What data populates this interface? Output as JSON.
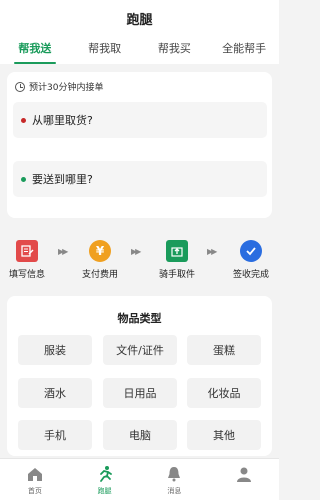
{
  "header": {
    "title": "跑腿"
  },
  "tabs": [
    {
      "label": "帮我送",
      "active": true
    },
    {
      "label": "帮我取",
      "active": false
    },
    {
      "label": "帮我买",
      "active": false
    },
    {
      "label": "全能帮手",
      "active": false
    }
  ],
  "address_card": {
    "eta": "预计30分钟内接单",
    "pickup_placeholder": "从哪里取货?",
    "drop_placeholder": "要送到哪里?"
  },
  "steps": [
    {
      "label": "填写信息",
      "icon": "form-edit-icon"
    },
    {
      "label": "支付费用",
      "icon": "yen-coin-icon"
    },
    {
      "label": "骑手取件",
      "icon": "package-up-icon"
    },
    {
      "label": "签收完成",
      "icon": "check-circle-icon"
    }
  ],
  "items": {
    "title": "物品类型",
    "options": [
      "服装",
      "文件/证件",
      "蛋糕",
      "酒水",
      "日用品",
      "化妆品",
      "手机",
      "电脑",
      "其他"
    ]
  },
  "bottom_nav": [
    {
      "label": "首页",
      "icon": "home-icon",
      "active": false
    },
    {
      "label": "跑腿",
      "icon": "runner-icon",
      "active": true
    },
    {
      "label": "消息",
      "icon": "bell-icon",
      "active": false
    },
    {
      "label": "",
      "icon": "profile-icon",
      "active": false
    }
  ],
  "colors": {
    "accent": "#1a9b5b",
    "pickup_dot": "#c62828",
    "step_form": "#e24a4a",
    "step_pay": "#f0a020",
    "step_pickup": "#1a9b5b",
    "step_done": "#2a6de0"
  }
}
